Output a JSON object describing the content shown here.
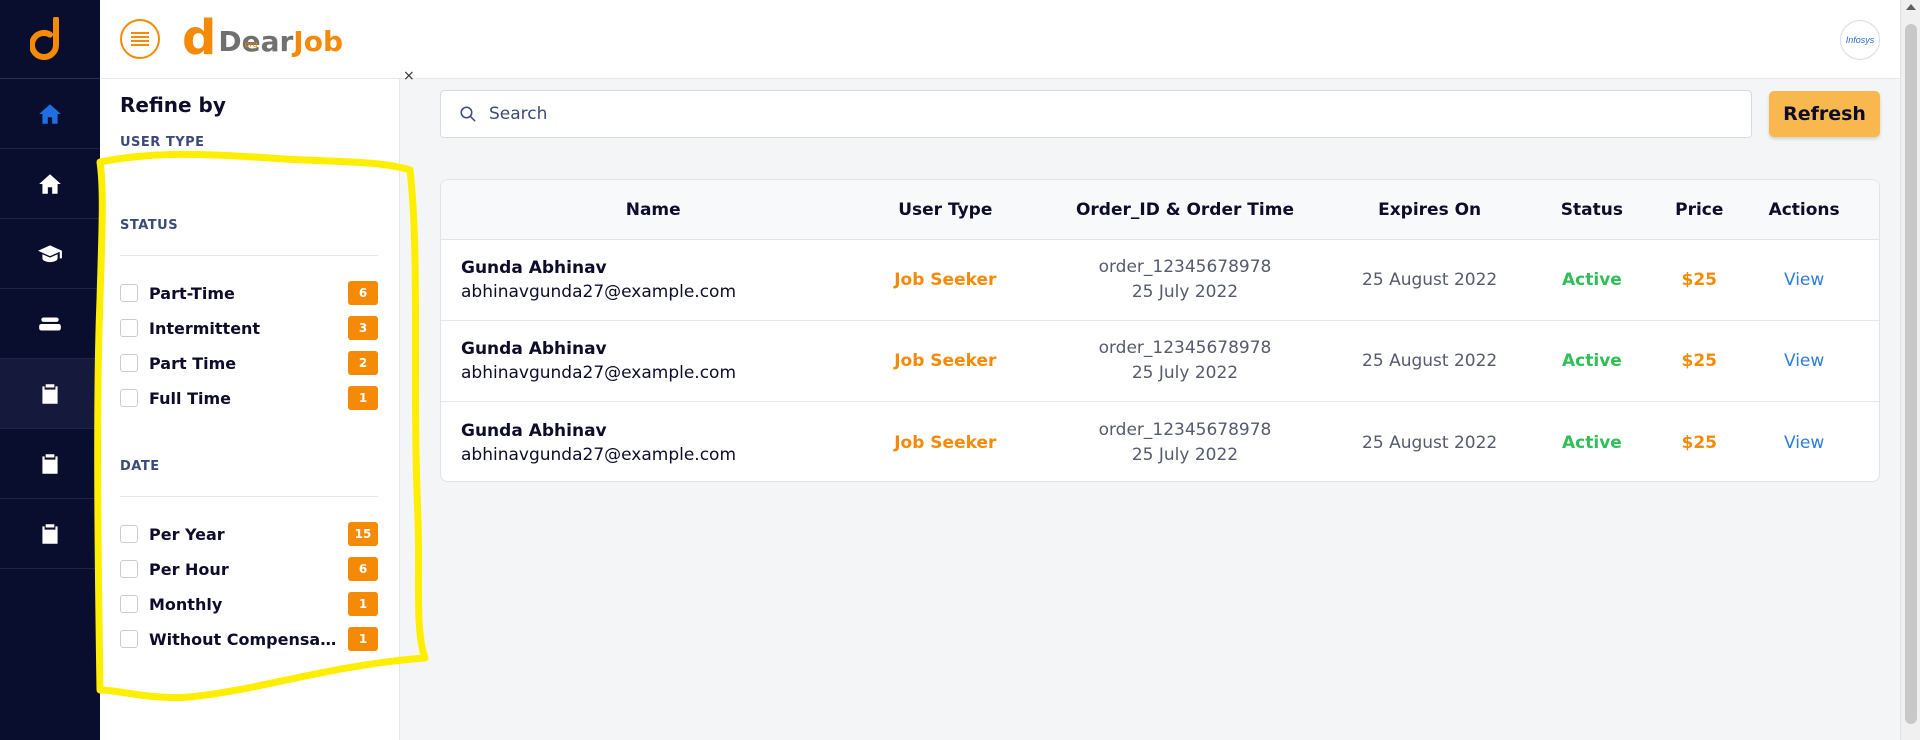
{
  "rail": {
    "items": [
      {
        "icon": "home-icon"
      },
      {
        "icon": "home-icon"
      },
      {
        "icon": "graduation-cap-icon"
      },
      {
        "icon": "layers-icon"
      },
      {
        "icon": "clipboard-icon"
      },
      {
        "icon": "clipboard-icon"
      },
      {
        "icon": "clipboard-icon"
      }
    ]
  },
  "header": {
    "brand_main": "Dear",
    "brand_accent": "Job",
    "brand_sub": ".org",
    "company": "Infosys"
  },
  "filters": {
    "title": "Refine by",
    "user_type_title": "USER TYPE",
    "status_title": "STATUS",
    "status_items": [
      {
        "label": "Part-Time",
        "count": "6"
      },
      {
        "label": "Intermittent",
        "count": "3"
      },
      {
        "label": "Part Time",
        "count": "2"
      },
      {
        "label": "Full Time",
        "count": "1"
      }
    ],
    "date_title": "DATE",
    "date_items": [
      {
        "label": "Per Year",
        "count": "15"
      },
      {
        "label": "Per Hour",
        "count": "6"
      },
      {
        "label": "Monthly",
        "count": "1"
      },
      {
        "label": "Without Compensation",
        "count": "1"
      }
    ],
    "close_label": "×"
  },
  "search": {
    "placeholder": "Search"
  },
  "refresh_label": "Refresh",
  "table": {
    "headers": [
      "Name",
      "User Type",
      "Order_ID & Order Time",
      "Expires On",
      "Status",
      "Price",
      "Actions"
    ],
    "rows": [
      {
        "name": "Gunda Abhinav",
        "email": "abhinavgunda27@example.com",
        "user_type": "Job Seeker",
        "order_id": "order_12345678978",
        "order_time": "25 July 2022",
        "expires": "25 August 2022",
        "status": "Active",
        "price": "$25",
        "action": "View"
      },
      {
        "name": "Gunda Abhinav",
        "email": "abhinavgunda27@example.com",
        "user_type": "Job Seeker",
        "order_id": "order_12345678978",
        "order_time": "25 July 2022",
        "expires": "25 August 2022",
        "status": "Active",
        "price": "$25",
        "action": "View"
      },
      {
        "name": "Gunda Abhinav",
        "email": "abhinavgunda27@example.com",
        "user_type": "Job Seeker",
        "order_id": "order_12345678978",
        "order_time": "25 July 2022",
        "expires": "25 August 2022",
        "status": "Active",
        "price": "$25",
        "action": "View"
      }
    ]
  },
  "colors": {
    "accent": "#f58a07",
    "rail": "#0a0e2e",
    "annotation": "#ffee00",
    "active": "#2fbf57",
    "link": "#2b7de0"
  }
}
